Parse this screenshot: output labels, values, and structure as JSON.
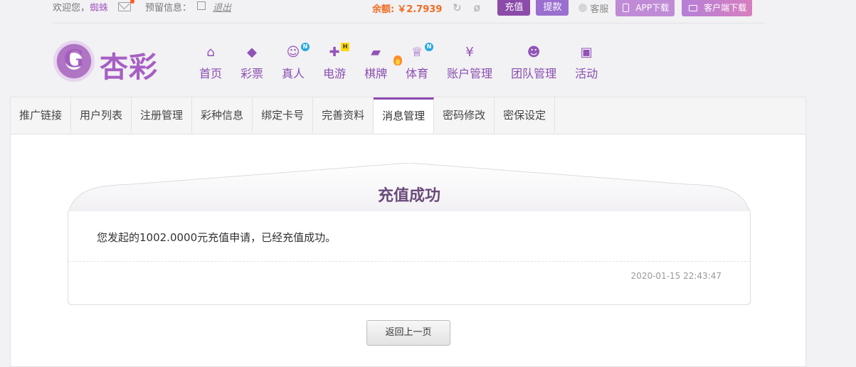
{
  "topbar": {
    "welcome_label": "欢迎您，",
    "username": "蜘蛛",
    "reserved_info_label": "预留信息：",
    "logout_label": "退出",
    "balance_label": "余额:",
    "balance_value": "￥2.7939",
    "deposit_label": "充值",
    "withdraw_label": "提款",
    "service_label": "客服",
    "app_download_label": "APP下载",
    "client_download_label": "客户端下载"
  },
  "logo": {
    "text": "杏彩"
  },
  "nav": {
    "items": [
      {
        "label": "首页",
        "icon": "home-icon"
      },
      {
        "label": "彩票",
        "icon": "lottery-ticket-icon"
      },
      {
        "label": "真人",
        "icon": "live-dealer-icon",
        "badge": "N"
      },
      {
        "label": "电游",
        "icon": "gamepad-icon",
        "badge": "H"
      },
      {
        "label": "棋牌",
        "icon": "cards-icon"
      },
      {
        "label": "体育",
        "icon": "trophy-icon",
        "badge": "N"
      },
      {
        "label": "账户管理",
        "icon": "yen-coin-icon"
      },
      {
        "label": "团队管理",
        "icon": "team-icon"
      },
      {
        "label": "活动",
        "icon": "gift-icon"
      }
    ]
  },
  "tabs": [
    {
      "label": "推广链接"
    },
    {
      "label": "用户列表"
    },
    {
      "label": "注册管理"
    },
    {
      "label": "彩种信息"
    },
    {
      "label": "绑定卡号"
    },
    {
      "label": "完善资料"
    },
    {
      "label": "消息管理",
      "active": true
    },
    {
      "label": "密码修改"
    },
    {
      "label": "密保设定"
    }
  ],
  "message": {
    "title": "充值成功",
    "body": "您发起的1002.0000元充值申请，已经充值成功。",
    "timestamp": "2020-01-15 22:43:47"
  },
  "back_button_label": "返回上一页",
  "colors": {
    "brand": "#8d4ab0",
    "balance": "#ef6c23"
  }
}
